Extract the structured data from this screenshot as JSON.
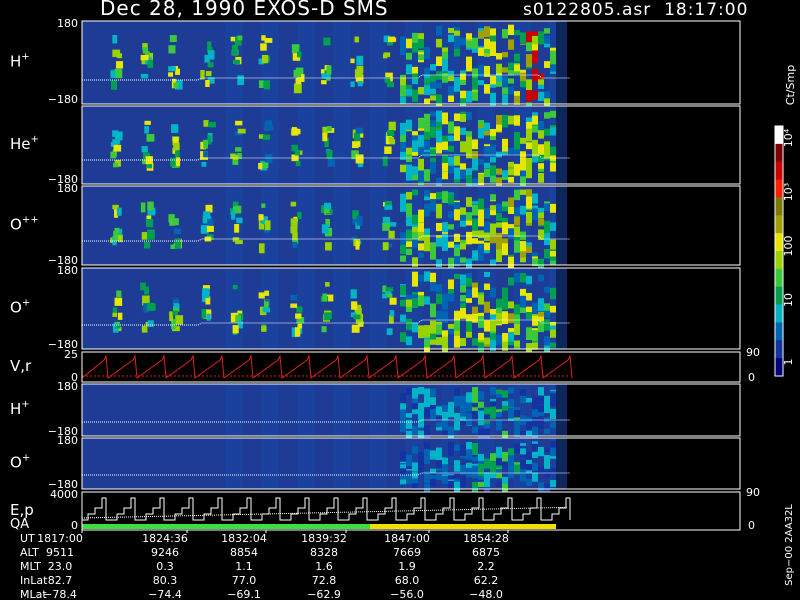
{
  "header": {
    "title": "Dec 28, 1990   EXOS-D SMS",
    "file": "s0122805.asr",
    "time": "18:17:00"
  },
  "colorbar": {
    "unit": "Ct/Smp",
    "labels": [
      "10⁴",
      "10³",
      "100",
      "10",
      "1"
    ],
    "colors": [
      "#ffffff",
      "#7a0000",
      "#c80000",
      "#ff1e00",
      "#7a7a00",
      "#a0a000",
      "#e6e600",
      "#9ad200",
      "#3cc83c",
      "#00a050",
      "#00b4c8",
      "#0064b4",
      "#1432a0",
      "#000078"
    ]
  },
  "chart_data": {
    "type": "heatmap",
    "panels": [
      {
        "id": "h-plus",
        "label": "H",
        "sup": "+",
        "ytop": "180",
        "ybot": "−180"
      },
      {
        "id": "he-plus",
        "label": "He",
        "sup": "+",
        "ytop": "",
        "ybot": "−180"
      },
      {
        "id": "o-plusplus",
        "label": "O",
        "sup": "++",
        "ytop": "180",
        "ybot": "−180"
      },
      {
        "id": "o-plus",
        "label": "O",
        "sup": "+",
        "ytop": "180",
        "ybot": "−180"
      },
      {
        "id": "vr",
        "label": "V,r",
        "sup": "",
        "ytop": "25",
        "ybot": "0",
        "rtop": "90",
        "rbot": "0"
      },
      {
        "id": "h-plus-2",
        "label": "H",
        "sup": "+",
        "ytop": "180",
        "ybot": "−180"
      },
      {
        "id": "o-plus-2",
        "label": "O",
        "sup": "+",
        "ytop": "180",
        "ybot": "−180"
      },
      {
        "id": "ep",
        "label": "E,p",
        "sup": "",
        "label2": "QA",
        "ytop": "4000",
        "ybot": "0",
        "rtop": "90",
        "rbot": "0"
      }
    ],
    "time_ticks": [
      "1817:00",
      "1824:36",
      "1832:04",
      "1839:32",
      "1847:00",
      "1854:28"
    ],
    "ephemeris": [
      {
        "name": "UT",
        "values": [
          "1817:00",
          "1824:36",
          "1832:04",
          "1839:32",
          "1847:00",
          "1854:28"
        ]
      },
      {
        "name": "ALT",
        "values": [
          "9511",
          "9246",
          "8854",
          "8328",
          "7669",
          "6875"
        ]
      },
      {
        "name": "MLT",
        "values": [
          "23.0",
          "0.3",
          "1.1",
          "1.6",
          "1.9",
          "2.2"
        ]
      },
      {
        "name": "InLat",
        "values": [
          "82.7",
          "80.3",
          "77.0",
          "72.8",
          "68.0",
          "62.2"
        ]
      },
      {
        "name": "MLat",
        "values": [
          "−78.4",
          "−74.4",
          "−69.1",
          "−62.9",
          "−56.0",
          "−48.0"
        ]
      }
    ],
    "side_label": "Sep−00  2AA32L"
  }
}
